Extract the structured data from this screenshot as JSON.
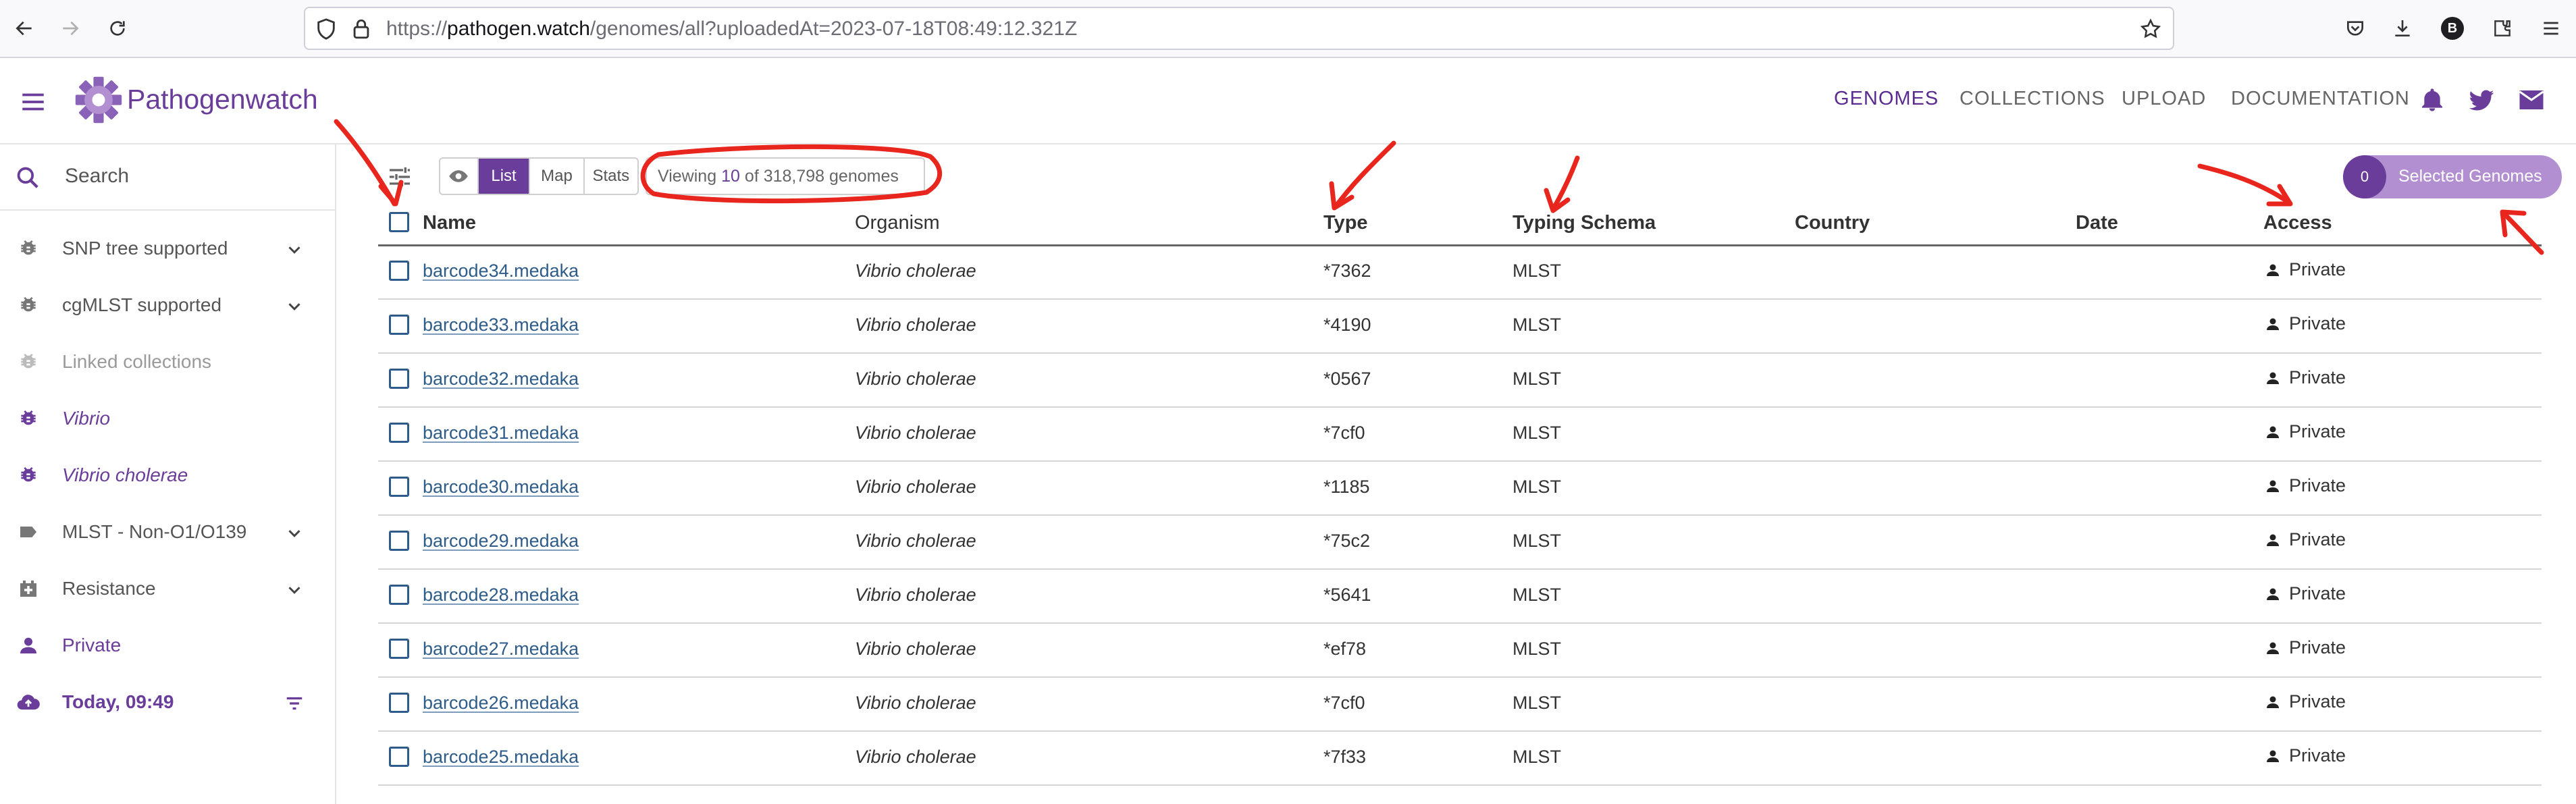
{
  "browser": {
    "url_prefix": "https://",
    "url_host": "pathogen.watch",
    "url_path": "/genomes/all?uploadedAt=2023-07-18T08:49:12.321Z",
    "profile_initial": "B"
  },
  "header": {
    "logo_part1": "Pathogen",
    "logo_part2": "watch",
    "nav": [
      "GENOMES",
      "COLLECTIONS",
      "UPLOAD",
      "DOCUMENTATION"
    ],
    "active_nav": "GENOMES",
    "brand_color": "#6a3d9a"
  },
  "sidebar": {
    "search_placeholder": "Search",
    "items": [
      {
        "label": "SNP tree supported",
        "icon": "bug-icon",
        "chevron": true,
        "style": "normal"
      },
      {
        "label": "cgMLST supported",
        "icon": "bug-icon",
        "chevron": true,
        "style": "normal"
      },
      {
        "label": "Linked collections",
        "icon": "bug-icon",
        "chevron": false,
        "style": "muted"
      },
      {
        "label": "Vibrio",
        "icon": "bug-icon",
        "chevron": false,
        "style": "purple-italic"
      },
      {
        "label": "Vibrio cholerae",
        "icon": "bug-icon",
        "chevron": false,
        "style": "purple-italic"
      },
      {
        "label": "MLST - Non-O1/O139",
        "icon": "label-icon",
        "chevron": true,
        "style": "normal"
      },
      {
        "label": "Resistance",
        "icon": "medical-icon",
        "chevron": true,
        "style": "normal"
      },
      {
        "label": "Private",
        "icon": "person-icon",
        "chevron": false,
        "style": "purple"
      },
      {
        "label": "Today, 09:49",
        "icon": "cloud-upload-icon",
        "chevron": false,
        "style": "purple-bold"
      }
    ]
  },
  "toolbar": {
    "views": [
      "List",
      "Map",
      "Stats"
    ],
    "active_view": "List",
    "viewing_prefix": "Viewing",
    "viewing_count": "10",
    "viewing_suffix": "of 318,798 genomes",
    "selected_count": "0",
    "selected_label": "Selected Genomes"
  },
  "table": {
    "columns": [
      "Name",
      "Organism",
      "Type",
      "Typing Schema",
      "Country",
      "Date",
      "Access"
    ],
    "rows": [
      {
        "name": "barcode34.medaka",
        "organism": "Vibrio cholerae",
        "type": "*7362",
        "schema": "MLST",
        "country": "",
        "date": "",
        "access": "Private"
      },
      {
        "name": "barcode33.medaka",
        "organism": "Vibrio cholerae",
        "type": "*4190",
        "schema": "MLST",
        "country": "",
        "date": "",
        "access": "Private"
      },
      {
        "name": "barcode32.medaka",
        "organism": "Vibrio cholerae",
        "type": "*0567",
        "schema": "MLST",
        "country": "",
        "date": "",
        "access": "Private"
      },
      {
        "name": "barcode31.medaka",
        "organism": "Vibrio cholerae",
        "type": "*7cf0",
        "schema": "MLST",
        "country": "",
        "date": "",
        "access": "Private"
      },
      {
        "name": "barcode30.medaka",
        "organism": "Vibrio cholerae",
        "type": "*1185",
        "schema": "MLST",
        "country": "",
        "date": "",
        "access": "Private"
      },
      {
        "name": "barcode29.medaka",
        "organism": "Vibrio cholerae",
        "type": "*75c2",
        "schema": "MLST",
        "country": "",
        "date": "",
        "access": "Private"
      },
      {
        "name": "barcode28.medaka",
        "organism": "Vibrio cholerae",
        "type": "*5641",
        "schema": "MLST",
        "country": "",
        "date": "",
        "access": "Private"
      },
      {
        "name": "barcode27.medaka",
        "organism": "Vibrio cholerae",
        "type": "*ef78",
        "schema": "MLST",
        "country": "",
        "date": "",
        "access": "Private"
      },
      {
        "name": "barcode26.medaka",
        "organism": "Vibrio cholerae",
        "type": "*7cf0",
        "schema": "MLST",
        "country": "",
        "date": "",
        "access": "Private"
      },
      {
        "name": "barcode25.medaka",
        "organism": "Vibrio cholerae",
        "type": "*7f33",
        "schema": "MLST",
        "country": "",
        "date": "",
        "access": "Private"
      }
    ]
  },
  "annotation_color": "#e8261e"
}
